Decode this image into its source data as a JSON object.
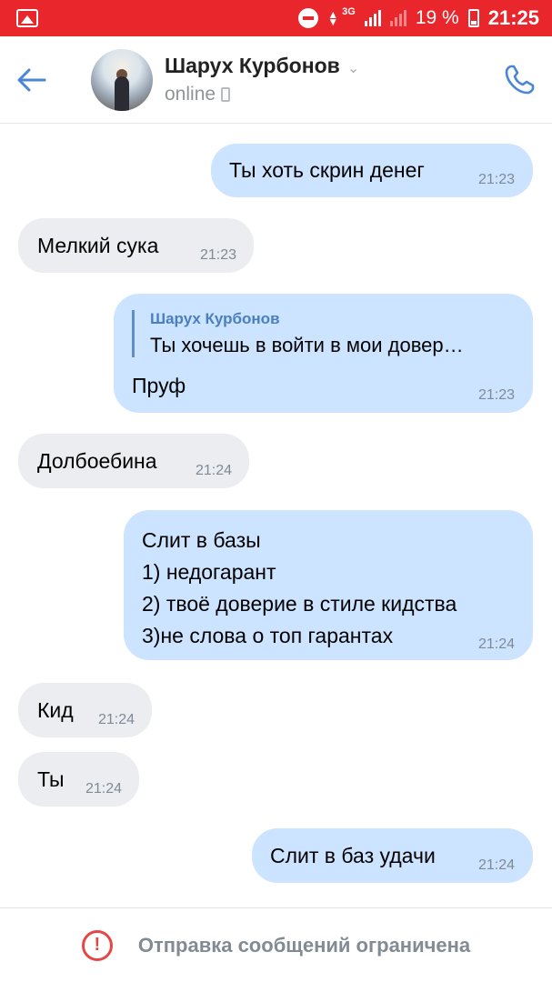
{
  "status_bar": {
    "network": "3G",
    "battery": "19 %",
    "time": "21:25",
    "icons": [
      "gallery-icon",
      "do-not-disturb-icon",
      "data-arrows-icon",
      "signal-icon",
      "signal-weak-icon",
      "battery-charging-icon"
    ],
    "color": "#e8262b"
  },
  "header": {
    "name": "Шарух Курбонов",
    "status": "online",
    "icons": [
      "back-arrow-icon",
      "chevron-down-icon",
      "mobile-phone-icon",
      "phone-call-icon"
    ],
    "accent": "#4a86d4"
  },
  "messages": [
    {
      "side": "out",
      "text": "Ты хоть скрин денег",
      "time": "21:23"
    },
    {
      "side": "in",
      "text": "Мелкий сука",
      "time": "21:23"
    },
    {
      "side": "out",
      "reply_to": {
        "name": "Шарух Курбонов",
        "text": "Ты хочешь в войти в мои довер…"
      },
      "text": "Пруф",
      "time": "21:23"
    },
    {
      "side": "in",
      "text": "Долбоебина",
      "time": "21:24"
    },
    {
      "side": "out",
      "lines": [
        "Слит в базы",
        "1) недогарант",
        "2) твоё доверие в стиле кидства",
        "3)не слова о топ гарантах"
      ],
      "time": "21:24"
    },
    {
      "side": "in",
      "text": "Кид",
      "time": "21:24"
    },
    {
      "side": "in",
      "text": "Ты",
      "time": "21:24"
    },
    {
      "side": "out",
      "text": "Слит в баз удачи",
      "time": "21:24"
    }
  ],
  "bottom": {
    "text": "Отправка сообщений ограничена",
    "icon": "warning-icon",
    "icon_color": "#e64646"
  },
  "colors": {
    "incoming_bubble": "#ebedf0",
    "outgoing_bubble": "#cce4ff",
    "timestamp": "#808a96"
  }
}
